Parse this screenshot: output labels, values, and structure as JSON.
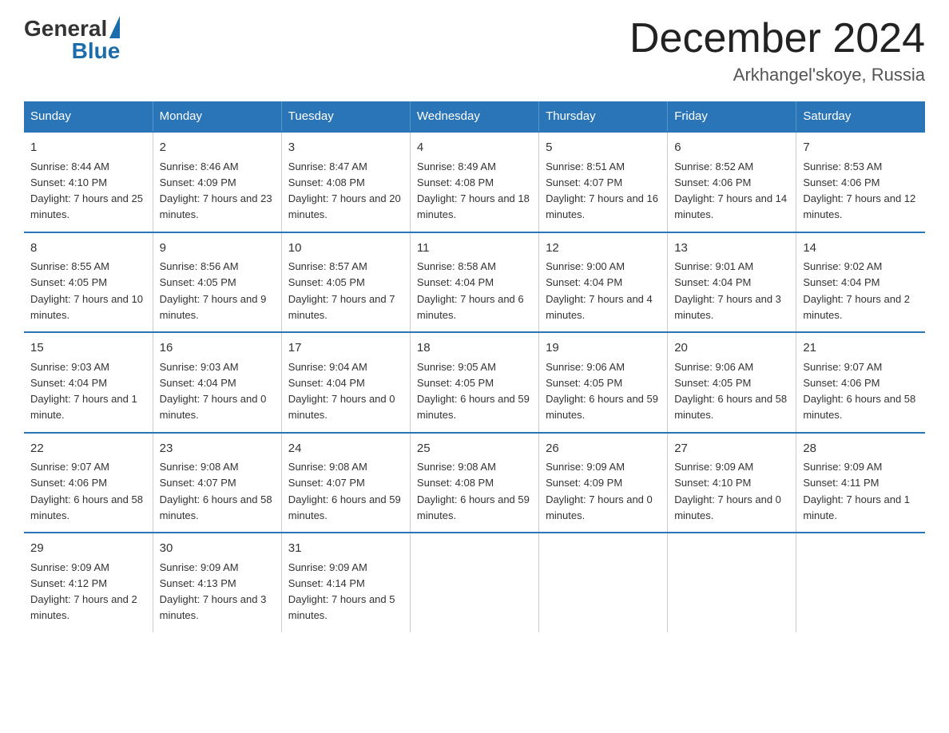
{
  "header": {
    "logo_general": "General",
    "logo_blue": "Blue",
    "month_title": "December 2024",
    "location": "Arkhangel'skoye, Russia"
  },
  "weekdays": [
    "Sunday",
    "Monday",
    "Tuesday",
    "Wednesday",
    "Thursday",
    "Friday",
    "Saturday"
  ],
  "weeks": [
    [
      {
        "day": "1",
        "sunrise": "8:44 AM",
        "sunset": "4:10 PM",
        "daylight": "7 hours and 25 minutes."
      },
      {
        "day": "2",
        "sunrise": "8:46 AM",
        "sunset": "4:09 PM",
        "daylight": "7 hours and 23 minutes."
      },
      {
        "day": "3",
        "sunrise": "8:47 AM",
        "sunset": "4:08 PM",
        "daylight": "7 hours and 20 minutes."
      },
      {
        "day": "4",
        "sunrise": "8:49 AM",
        "sunset": "4:08 PM",
        "daylight": "7 hours and 18 minutes."
      },
      {
        "day": "5",
        "sunrise": "8:51 AM",
        "sunset": "4:07 PM",
        "daylight": "7 hours and 16 minutes."
      },
      {
        "day": "6",
        "sunrise": "8:52 AM",
        "sunset": "4:06 PM",
        "daylight": "7 hours and 14 minutes."
      },
      {
        "day": "7",
        "sunrise": "8:53 AM",
        "sunset": "4:06 PM",
        "daylight": "7 hours and 12 minutes."
      }
    ],
    [
      {
        "day": "8",
        "sunrise": "8:55 AM",
        "sunset": "4:05 PM",
        "daylight": "7 hours and 10 minutes."
      },
      {
        "day": "9",
        "sunrise": "8:56 AM",
        "sunset": "4:05 PM",
        "daylight": "7 hours and 9 minutes."
      },
      {
        "day": "10",
        "sunrise": "8:57 AM",
        "sunset": "4:05 PM",
        "daylight": "7 hours and 7 minutes."
      },
      {
        "day": "11",
        "sunrise": "8:58 AM",
        "sunset": "4:04 PM",
        "daylight": "7 hours and 6 minutes."
      },
      {
        "day": "12",
        "sunrise": "9:00 AM",
        "sunset": "4:04 PM",
        "daylight": "7 hours and 4 minutes."
      },
      {
        "day": "13",
        "sunrise": "9:01 AM",
        "sunset": "4:04 PM",
        "daylight": "7 hours and 3 minutes."
      },
      {
        "day": "14",
        "sunrise": "9:02 AM",
        "sunset": "4:04 PM",
        "daylight": "7 hours and 2 minutes."
      }
    ],
    [
      {
        "day": "15",
        "sunrise": "9:03 AM",
        "sunset": "4:04 PM",
        "daylight": "7 hours and 1 minute."
      },
      {
        "day": "16",
        "sunrise": "9:03 AM",
        "sunset": "4:04 PM",
        "daylight": "7 hours and 0 minutes."
      },
      {
        "day": "17",
        "sunrise": "9:04 AM",
        "sunset": "4:04 PM",
        "daylight": "7 hours and 0 minutes."
      },
      {
        "day": "18",
        "sunrise": "9:05 AM",
        "sunset": "4:05 PM",
        "daylight": "6 hours and 59 minutes."
      },
      {
        "day": "19",
        "sunrise": "9:06 AM",
        "sunset": "4:05 PM",
        "daylight": "6 hours and 59 minutes."
      },
      {
        "day": "20",
        "sunrise": "9:06 AM",
        "sunset": "4:05 PM",
        "daylight": "6 hours and 58 minutes."
      },
      {
        "day": "21",
        "sunrise": "9:07 AM",
        "sunset": "4:06 PM",
        "daylight": "6 hours and 58 minutes."
      }
    ],
    [
      {
        "day": "22",
        "sunrise": "9:07 AM",
        "sunset": "4:06 PM",
        "daylight": "6 hours and 58 minutes."
      },
      {
        "day": "23",
        "sunrise": "9:08 AM",
        "sunset": "4:07 PM",
        "daylight": "6 hours and 58 minutes."
      },
      {
        "day": "24",
        "sunrise": "9:08 AM",
        "sunset": "4:07 PM",
        "daylight": "6 hours and 59 minutes."
      },
      {
        "day": "25",
        "sunrise": "9:08 AM",
        "sunset": "4:08 PM",
        "daylight": "6 hours and 59 minutes."
      },
      {
        "day": "26",
        "sunrise": "9:09 AM",
        "sunset": "4:09 PM",
        "daylight": "7 hours and 0 minutes."
      },
      {
        "day": "27",
        "sunrise": "9:09 AM",
        "sunset": "4:10 PM",
        "daylight": "7 hours and 0 minutes."
      },
      {
        "day": "28",
        "sunrise": "9:09 AM",
        "sunset": "4:11 PM",
        "daylight": "7 hours and 1 minute."
      }
    ],
    [
      {
        "day": "29",
        "sunrise": "9:09 AM",
        "sunset": "4:12 PM",
        "daylight": "7 hours and 2 minutes."
      },
      {
        "day": "30",
        "sunrise": "9:09 AM",
        "sunset": "4:13 PM",
        "daylight": "7 hours and 3 minutes."
      },
      {
        "day": "31",
        "sunrise": "9:09 AM",
        "sunset": "4:14 PM",
        "daylight": "7 hours and 5 minutes."
      },
      null,
      null,
      null,
      null
    ]
  ]
}
